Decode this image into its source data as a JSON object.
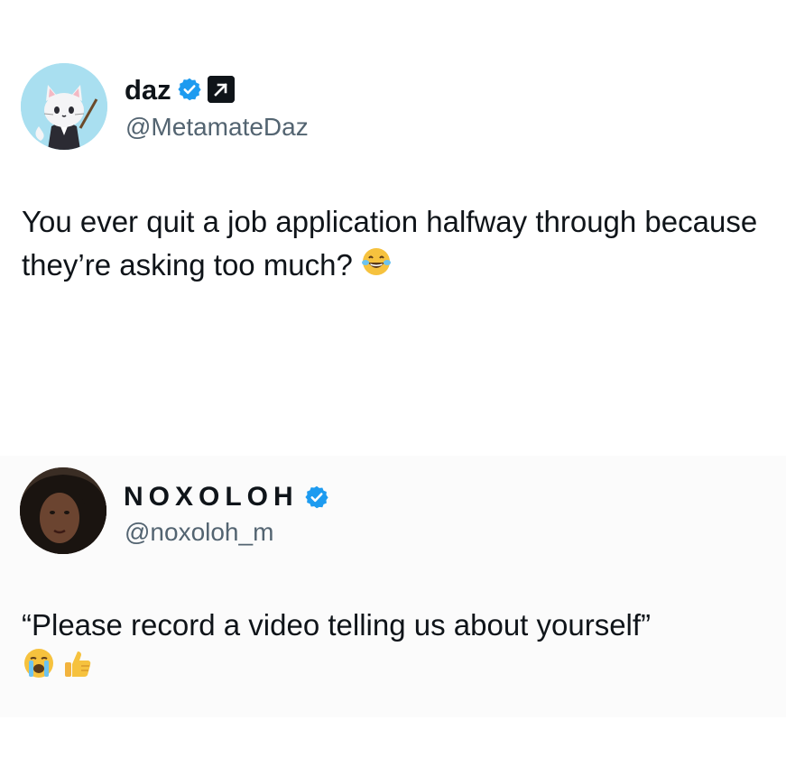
{
  "tweets": [
    {
      "display_name": "daz",
      "handle": "@MetamateDaz",
      "verified": true,
      "affiliate_badge": true,
      "text": "You ever quit a job application halfway through because they’re asking too much?",
      "emojis": [
        "laughing-tears-emoji"
      ]
    },
    {
      "display_name": "NOXOLOH",
      "handle": "@noxoloh_m",
      "verified": true,
      "text": "“Please record a video telling us about yourself”",
      "emojis": [
        "loudly-crying-emoji",
        "thumbs-up-emoji"
      ]
    }
  ],
  "colors": {
    "verified_blue": "#1d9bf0",
    "text_primary": "#0f1419",
    "text_secondary": "#536471"
  }
}
